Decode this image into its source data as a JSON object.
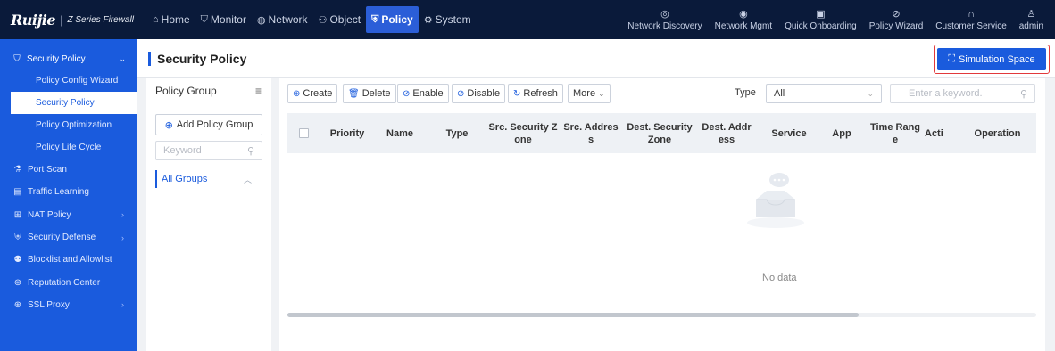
{
  "brand": {
    "logo": "Ruijie",
    "separator": "|",
    "product": "Z Series Firewall"
  },
  "main_nav": [
    {
      "label": "Home",
      "icon": "home-icon",
      "active": false
    },
    {
      "label": "Monitor",
      "icon": "shield-icon",
      "active": false
    },
    {
      "label": "Network",
      "icon": "globe-icon",
      "active": false
    },
    {
      "label": "Object",
      "icon": "users-icon",
      "active": false
    },
    {
      "label": "Policy",
      "icon": "policy-icon",
      "active": true
    },
    {
      "label": "System",
      "icon": "gear-icon",
      "active": false
    }
  ],
  "right_nav": [
    {
      "label": "Network Discovery",
      "icon": "radar-icon"
    },
    {
      "label": "Network Mgmt",
      "icon": "network-mgmt-icon"
    },
    {
      "label": "Quick Onboarding",
      "icon": "onboarding-icon"
    },
    {
      "label": "Policy Wizard",
      "icon": "wizard-icon"
    },
    {
      "label": "Customer Service",
      "icon": "headset-icon"
    },
    {
      "label": "admin",
      "icon": "user-icon"
    }
  ],
  "sidebar": {
    "section": {
      "label": "Security Policy",
      "icon": "security-policy-icon"
    },
    "sub_items": [
      {
        "label": "Policy Config Wizard",
        "active": false
      },
      {
        "label": "Security Policy",
        "active": true
      },
      {
        "label": "Policy Optimization",
        "active": false
      },
      {
        "label": "Policy Life Cycle",
        "active": false
      }
    ],
    "items": [
      {
        "label": "Port Scan",
        "icon": "port-scan-icon",
        "expandable": false
      },
      {
        "label": "Traffic Learning",
        "icon": "traffic-learning-icon",
        "expandable": false
      },
      {
        "label": "NAT Policy",
        "icon": "nat-icon",
        "expandable": true
      },
      {
        "label": "Security Defense",
        "icon": "defense-icon",
        "expandable": true
      },
      {
        "label": "Blocklist and Allowlist",
        "icon": "blocklist-icon",
        "expandable": false
      },
      {
        "label": "Reputation Center",
        "icon": "reputation-icon",
        "expandable": false
      },
      {
        "label": "SSL Proxy",
        "icon": "ssl-icon",
        "expandable": true
      }
    ]
  },
  "page": {
    "title": "Security Policy",
    "simulation_button": "Simulation Space"
  },
  "group_panel": {
    "title": "Policy Group",
    "add_button": "Add Policy Group",
    "keyword_placeholder": "Keyword",
    "groups": [
      {
        "label": "All Groups"
      }
    ]
  },
  "toolbar": {
    "create": "Create",
    "delete": "Delete",
    "enable": "Enable",
    "disable": "Disable",
    "refresh": "Refresh",
    "more": "More",
    "type_label": "Type",
    "type_value": "All",
    "search_placeholder": "Enter a keyword."
  },
  "table": {
    "columns": [
      "Priority",
      "Name",
      "Type",
      "Src. Security Z\none",
      "Src. Addres\ns",
      "Dest. Security\nZone",
      "Dest. Addr\ness",
      "Service",
      "App",
      "Time Rang\ne",
      "Acti",
      "Operation"
    ],
    "rows": [],
    "empty_text": "No data"
  },
  "colors": {
    "accent": "#1a5bdd",
    "topbar": "#0a1a3a",
    "highlight": "#e2393b"
  }
}
